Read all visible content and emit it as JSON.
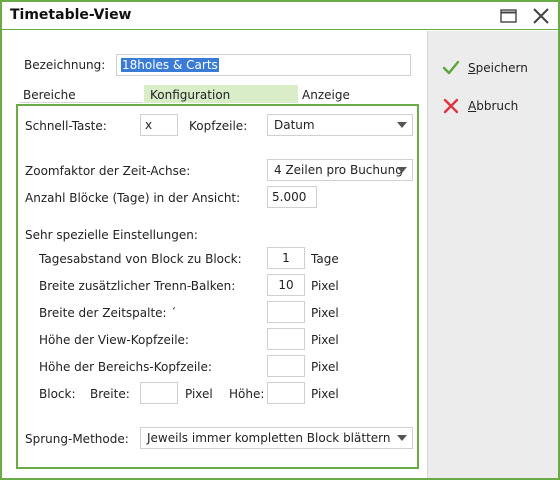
{
  "window": {
    "title": "Timetable-View",
    "maximize_icon": "maximize-icon",
    "close_icon": "close-icon"
  },
  "actions": {
    "save_label_underlined": "S",
    "save_label_rest": "peichern",
    "cancel_label_underlined": "A",
    "cancel_label_rest": "bbruch",
    "save_icon": "checkmark-icon",
    "cancel_icon": "cross-icon"
  },
  "form": {
    "bezeichnung_label": "Bezeichnung:",
    "bezeichnung_value": "18holes & Carts"
  },
  "tabs": [
    {
      "label": "Bereiche",
      "active": false
    },
    {
      "label": "Konfiguration",
      "active": true
    },
    {
      "label": "Anzeige",
      "active": false
    }
  ],
  "config": {
    "schnell_taste_label": "Schnell-Taste:",
    "schnell_taste_value": "x",
    "kopfzeile_label": "Kopfzeile:",
    "kopfzeile_value": "Datum",
    "zoom_label": "Zoomfaktor der Zeit-Achse:",
    "zoom_value": "4 Zeilen pro Buchung",
    "bloecke_label": "Anzahl Blöcke (Tage) in der Ansicht:",
    "bloecke_value": "5.000",
    "special_heading": "Sehr spezielle Einstellungen:",
    "tagesabstand_label": "Tagesabstand von Block zu Block:",
    "tagesabstand_value": "1",
    "tagesabstand_unit": "Tage",
    "trenn_label": "Breite zusätzlicher Trenn-Balken:",
    "trenn_value": "10",
    "trenn_unit": "Pixel",
    "zeitspalte_label": "Breite der Zeitspalte: ´",
    "zeitspalte_value": "",
    "zeitspalte_unit": "Pixel",
    "view_kopf_label": "Höhe der View-Kopfzeile:",
    "view_kopf_value": "",
    "view_kopf_unit": "Pixel",
    "bereich_kopf_label": "Höhe der Bereichs-Kopfzeile:",
    "bereich_kopf_value": "",
    "bereich_kopf_unit": "Pixel",
    "block_label": "Block:",
    "breite_label": "Breite:",
    "block_breite_value": "",
    "block_breite_unit": "Pixel",
    "hoehe_label": "Höhe:",
    "block_hoehe_value": "",
    "block_hoehe_unit": "Pixel",
    "sprung_label": "Sprung-Methode:",
    "sprung_value": "Jeweils immer kompletten Block blättern"
  },
  "colors": {
    "accent_green": "#6aab47",
    "tab_active_bg": "#d9edc9",
    "side_bg": "#ececec",
    "selection_blue": "#3a7bd5",
    "cancel_red": "#e0353f"
  }
}
